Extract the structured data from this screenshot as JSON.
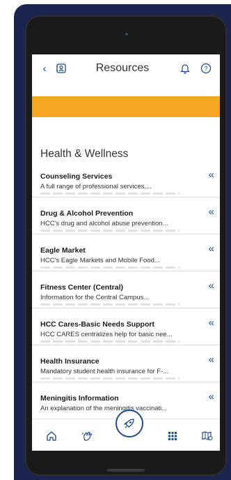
{
  "header": {
    "back_label": "‹",
    "title": "Resources"
  },
  "section": {
    "title": "Health & Wellness"
  },
  "resources": [
    {
      "name": "Counseling Services",
      "description": "A full range of professional services,..."
    },
    {
      "name": "Drug & Alcohol Prevention",
      "description": "HCC's drug and alcohol abuse prevention..."
    },
    {
      "name": "Eagle Market",
      "description": "HCC's Eagle Markets and Mobile Food..."
    },
    {
      "name": "Fitness Center (Central)",
      "description": "Information for the Central Campus..."
    },
    {
      "name": "HCC Cares-Basic Needs Support",
      "description": "HCC CARES centralizes help for basic nee..."
    },
    {
      "name": "Health Insurance",
      "description": "Mandatory student health insurance for F-..."
    },
    {
      "name": "Meningitis Information",
      "description": "An explanation of the meningitis vaccinati..."
    }
  ],
  "expand_glyph": "«",
  "colors": {
    "accent": "#1e4b8f",
    "banner": "#f6a623",
    "frame": "#1c2450"
  },
  "bottom_nav": [
    "home-icon",
    "hand-wave-icon",
    "rocket-icon",
    "grid-icon",
    "map-icon"
  ]
}
